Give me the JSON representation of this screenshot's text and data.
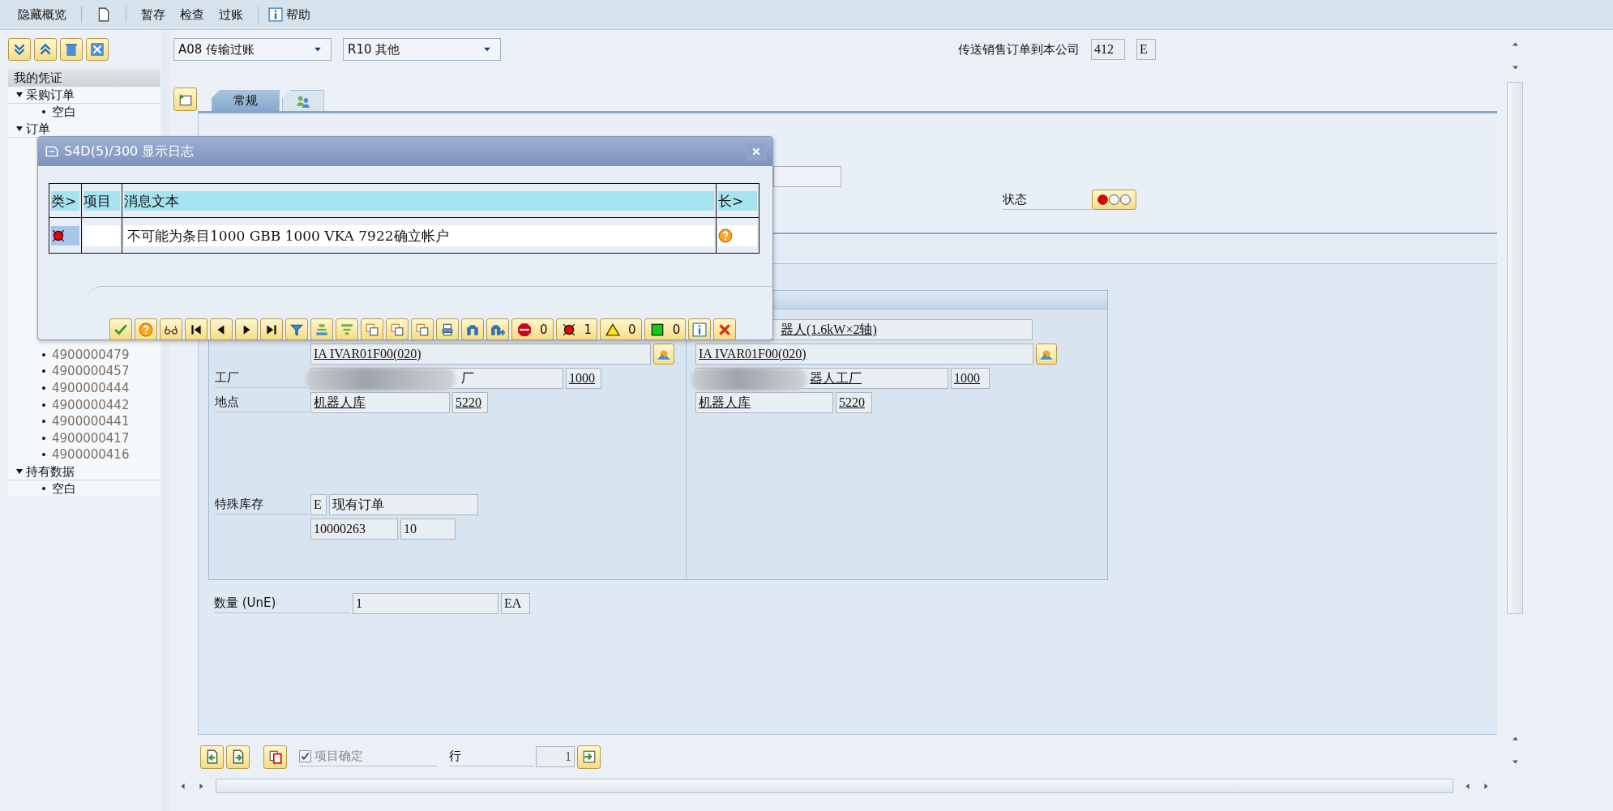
{
  "toolbar": {
    "hide_overview": "隐藏概览",
    "actions": [
      "暂存",
      "检查",
      "过账"
    ],
    "help": "帮助"
  },
  "sidebar": {
    "header": "我的凭证",
    "groups": [
      {
        "label": "采购订单",
        "expanded": true,
        "children": [
          {
            "label": "空白",
            "kind": "placeholder"
          }
        ]
      },
      {
        "label": "订单",
        "expanded": true
      },
      {
        "children": [
          {
            "label": "4900000479",
            "kind": "document"
          },
          {
            "label": "4900000457",
            "kind": "document"
          },
          {
            "label": "4900000444",
            "kind": "document"
          },
          {
            "label": "4900000442",
            "kind": "document"
          },
          {
            "label": "4900000441",
            "kind": "document"
          },
          {
            "label": "4900000417",
            "kind": "document"
          },
          {
            "label": "4900000416",
            "kind": "document"
          }
        ]
      },
      {
        "label": "持有数据",
        "expanded": true,
        "children": [
          {
            "label": "空白",
            "kind": "placeholder"
          }
        ]
      }
    ]
  },
  "header": {
    "transaction": "A08 传输过账",
    "reference": "R10 其他",
    "transfer_label": "传送销售订单到本公司",
    "transfer_code": "412",
    "transfer_flag": "E"
  },
  "tabs": [
    {
      "label": "常规",
      "selected": true
    },
    {
      "selected": false
    }
  ],
  "status": {
    "label": "状态",
    "lights": [
      {
        "on": true
      },
      {
        "on": false
      },
      {
        "on": false
      }
    ]
  },
  "item": {
    "left": {
      "material_code": "IA IVAR01F00(020)",
      "plant_label": "工厂",
      "plant_name": "厂",
      "plant": "1000",
      "location_label": "地点",
      "location_name": "机器人库",
      "location": "5220",
      "special_stock_label": "特殊库存",
      "special_stock_code": "E",
      "special_stock_text": "现有订单",
      "order": "10000263",
      "order_item": "10"
    },
    "right": {
      "material_text": "器人(1.6kW×2轴)",
      "material_code": "IA IVAR01F00(020)",
      "plant_name": "器人工厂",
      "plant": "1000",
      "location_name": "机器人库",
      "location": "5220"
    }
  },
  "quantity": {
    "label": "数量 (UnE)",
    "value": "1",
    "unit": "EA"
  },
  "footer": {
    "item_ok": {
      "label": "项目确定",
      "checked": true,
      "disabled": true
    },
    "line_label": "行",
    "line": "1"
  },
  "dialog": {
    "title": "S4D(5)/300 显示日志",
    "columns": [
      "类>",
      "项目",
      "消息文本",
      "长>"
    ],
    "messages": [
      {
        "kind": "error",
        "text": "不可能为条目1000 GBB 1000 VKA 7922确立帐户"
      }
    ],
    "counts": [
      {
        "kind": "stop",
        "count": "0"
      },
      {
        "kind": "error",
        "count": "1"
      },
      {
        "kind": "warning",
        "count": "0"
      },
      {
        "kind": "success",
        "count": "0"
      }
    ]
  }
}
